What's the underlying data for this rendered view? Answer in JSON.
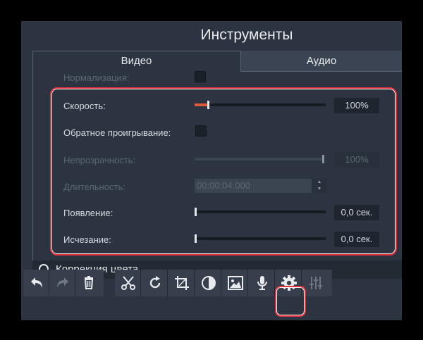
{
  "window": {
    "title": "Инструменты"
  },
  "tabs": [
    {
      "label": "Видео",
      "active": true
    },
    {
      "label": "Аудио",
      "active": false
    }
  ],
  "settings": {
    "normalization": {
      "label": "Нормализация:"
    },
    "speed": {
      "label": "Скорость:",
      "value": "100%",
      "level": 0.1
    },
    "reverse": {
      "label": "Обратное проигрывание:"
    },
    "opacity": {
      "label": "Непрозрачность:",
      "value": "100%",
      "level": 1.0
    },
    "duration": {
      "label": "Длительность:",
      "value": "00:00:04.000"
    },
    "fade_in": {
      "label": "Появление:",
      "value": "0,0 сек.",
      "level": 0.0
    },
    "fade_out": {
      "label": "Исчезание:",
      "value": "0,0 сек.",
      "level": 0.0
    }
  },
  "color_correction": {
    "label": "Коррекция цвета"
  },
  "toolbar": [
    "undo-icon",
    "redo-icon",
    "trash-icon",
    "scissors-icon",
    "rotate-icon",
    "crop-icon",
    "contrast-icon",
    "image-icon",
    "microphone-icon",
    "gear-icon",
    "equalizer-icon"
  ],
  "colors": {
    "accent": "#e05a3a",
    "highlight": "#e0313f",
    "panel": "#2b3440"
  }
}
